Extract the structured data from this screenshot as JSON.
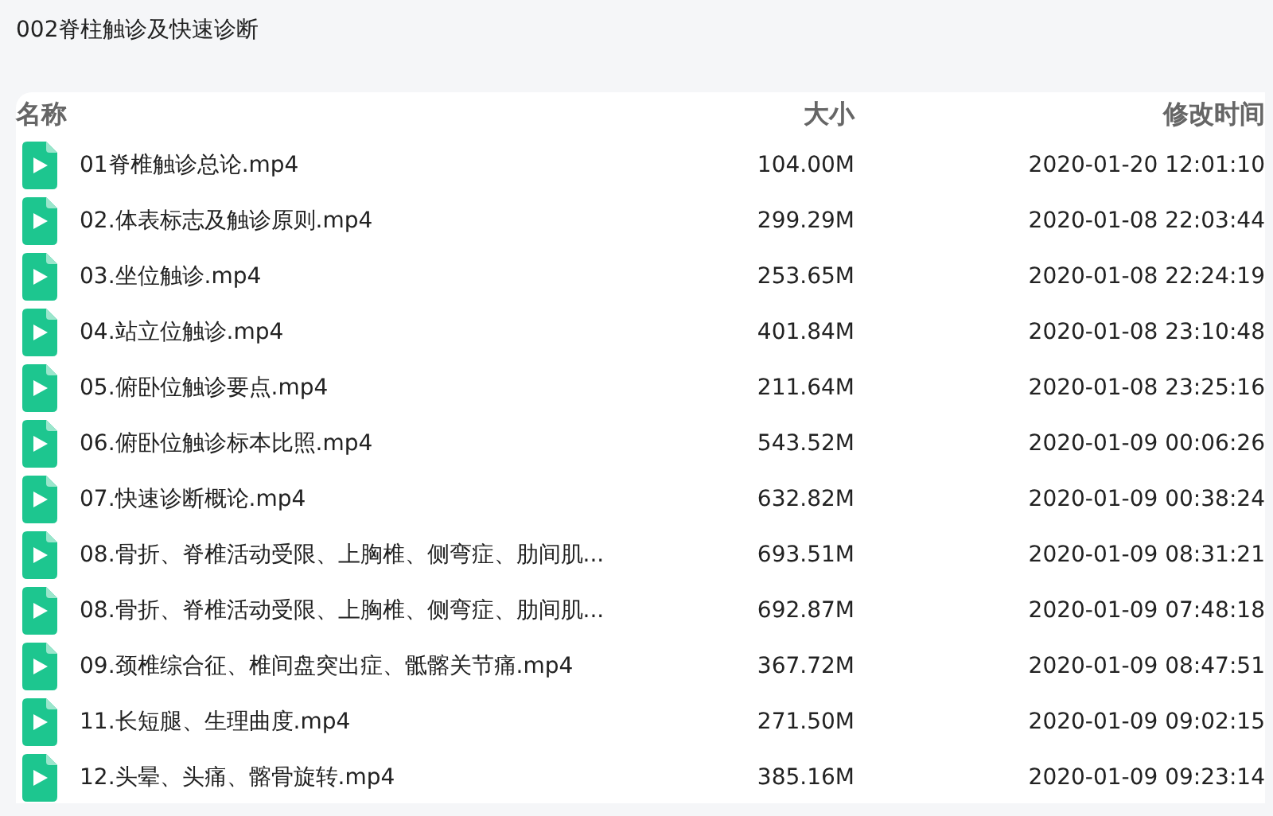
{
  "folder_title": "002脊柱触诊及快速诊断",
  "table": {
    "columns": [
      "名称",
      "大小",
      "修改时间"
    ],
    "rows": [
      {
        "kind": "video",
        "name": "01脊椎触诊总论.mp4",
        "size": "104.00M",
        "modified": "2020-01-20 12:01:10"
      },
      {
        "kind": "video",
        "name": "02.体表标志及触诊原则.mp4",
        "size": "299.29M",
        "modified": "2020-01-08 22:03:44"
      },
      {
        "kind": "video",
        "name": "03.坐位触诊.mp4",
        "size": "253.65M",
        "modified": "2020-01-08 22:24:19"
      },
      {
        "kind": "video",
        "name": "04.站立位触诊.mp4",
        "size": "401.84M",
        "modified": "2020-01-08 23:10:48"
      },
      {
        "kind": "video",
        "name": "05.俯卧位触诊要点.mp4",
        "size": "211.64M",
        "modified": "2020-01-08 23:25:16"
      },
      {
        "kind": "video",
        "name": "06.俯卧位触诊标本比照.mp4",
        "size": "543.52M",
        "modified": "2020-01-09 00:06:26"
      },
      {
        "kind": "video",
        "name": "07.快速诊断概论.mp4",
        "size": "632.82M",
        "modified": "2020-01-09 00:38:24"
      },
      {
        "kind": "video",
        "name": "08.骨折、脊椎活动受限、上胸椎、侧弯症、肋间肌...",
        "size": "693.51M",
        "modified": "2020-01-09 08:31:21"
      },
      {
        "kind": "video",
        "name": "08.骨折、脊椎活动受限、上胸椎、侧弯症、肋间肌...",
        "size": "692.87M",
        "modified": "2020-01-09 07:48:18"
      },
      {
        "kind": "video",
        "name": "09.颈椎综合征、椎间盘突出症、骶髂关节痛.mp4",
        "size": "367.72M",
        "modified": "2020-01-09 08:47:51"
      },
      {
        "kind": "video",
        "name": "11.长短腿、生理曲度.mp4",
        "size": "271.50M",
        "modified": "2020-01-09 09:02:15"
      },
      {
        "kind": "video",
        "name": "12.头晕、头痛、髂骨旋转.mp4",
        "size": "385.16M",
        "modified": "2020-01-09 09:23:14"
      }
    ]
  }
}
